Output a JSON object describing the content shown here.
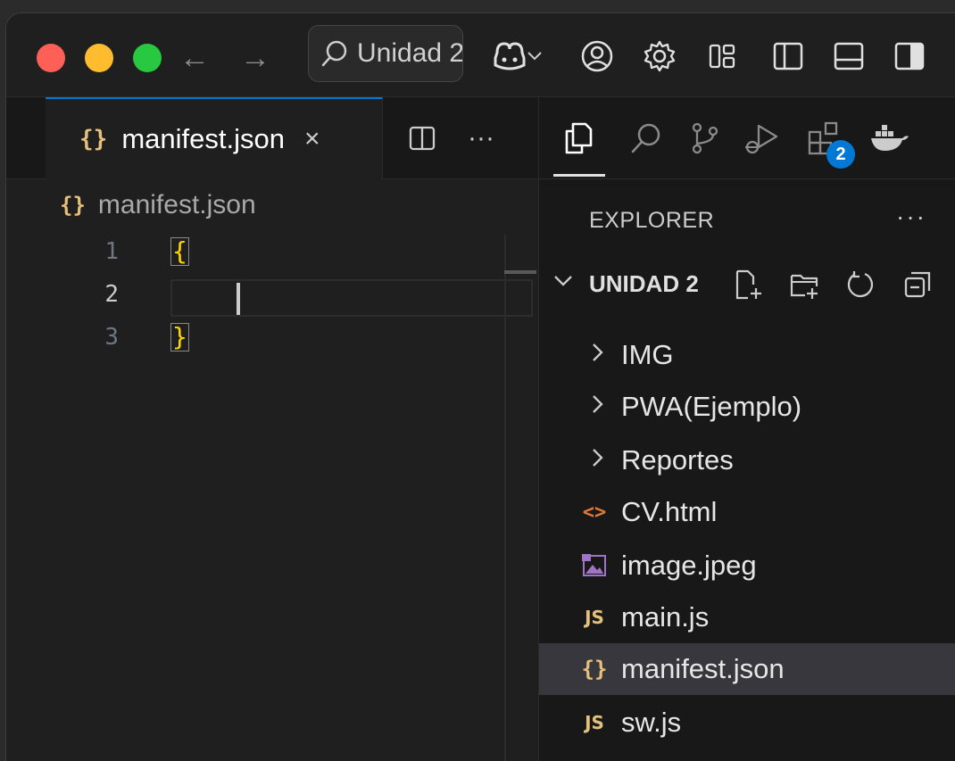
{
  "titlebar": {
    "search_text": "Unidad 2"
  },
  "editor": {
    "tab": {
      "label": "manifest.json",
      "icon": "json-braces-icon"
    },
    "breadcrumb": "manifest.json",
    "lines": [
      {
        "number": "1",
        "text": "{"
      },
      {
        "number": "2",
        "text": ""
      },
      {
        "number": "3",
        "text": "}"
      }
    ],
    "json_icon_glyph": "{}"
  },
  "sidebar": {
    "badge_count": "2",
    "explorer_title": "EXPLORER",
    "more_label": "···",
    "section_title": "UNIDAD 2",
    "tree": [
      {
        "label": "IMG",
        "type": "folder"
      },
      {
        "label": "PWA(Ejemplo)",
        "type": "folder"
      },
      {
        "label": "Reportes",
        "type": "folder"
      },
      {
        "label": "CV.html",
        "type": "html"
      },
      {
        "label": "image.jpeg",
        "type": "image"
      },
      {
        "label": "main.js",
        "type": "js"
      },
      {
        "label": "manifest.json",
        "type": "json",
        "selected": true
      },
      {
        "label": "sw.js",
        "type": "js"
      }
    ],
    "js_badge": "JS",
    "html_glyph": "<>"
  },
  "colors": {
    "accent": "#0078d4",
    "json_icon": "#e5c07b",
    "html_icon": "#e37933",
    "image_icon": "#a074c4"
  }
}
